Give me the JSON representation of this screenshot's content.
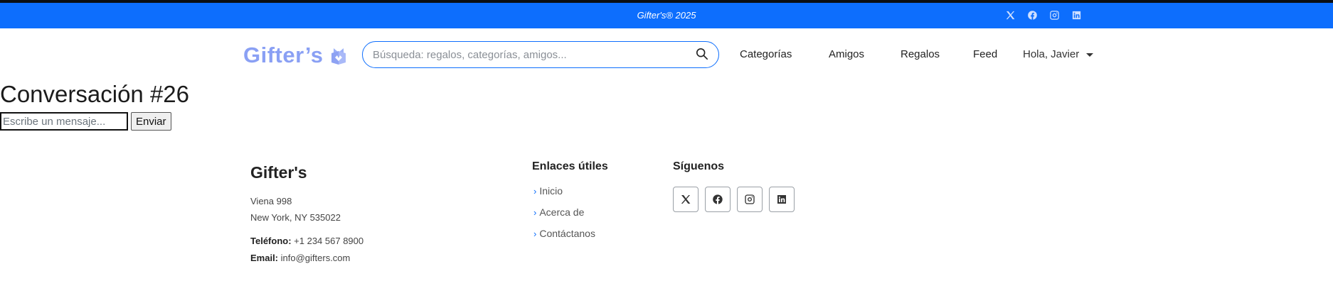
{
  "topbar": {
    "tagline": "Gifter's® 2025",
    "social_icons": [
      "x-icon",
      "facebook-icon",
      "instagram-icon",
      "linkedin-icon"
    ]
  },
  "navbar": {
    "logo_text": "Gifter’s",
    "search_placeholder": "Búsqueda: regalos, categorías, amigos...",
    "links": [
      "Categorías",
      "Amigos",
      "Regalos",
      "Feed"
    ],
    "user_greeting": "Hola, Javier"
  },
  "conversation": {
    "title": "Conversación #26",
    "message_placeholder": "Escribe un mensaje...",
    "send_label": "Enviar"
  },
  "footer": {
    "brand": "Gifter's",
    "address_line1": "Viena 998",
    "address_line2": "New York, NY 535022",
    "phone_label": "Teléfono:",
    "phone_value": "+1 234 567 8900",
    "email_label": "Email:",
    "email_value": "info@gifters.com",
    "links_heading": "Enlaces útiles",
    "links": [
      "Inicio",
      "Acerca de",
      "Contáctanos"
    ],
    "social_heading": "Síguenos"
  },
  "colors": {
    "topbar_bg": "#0d6efd",
    "logo": "#8aa0f4",
    "accent": "#0d6efd"
  }
}
